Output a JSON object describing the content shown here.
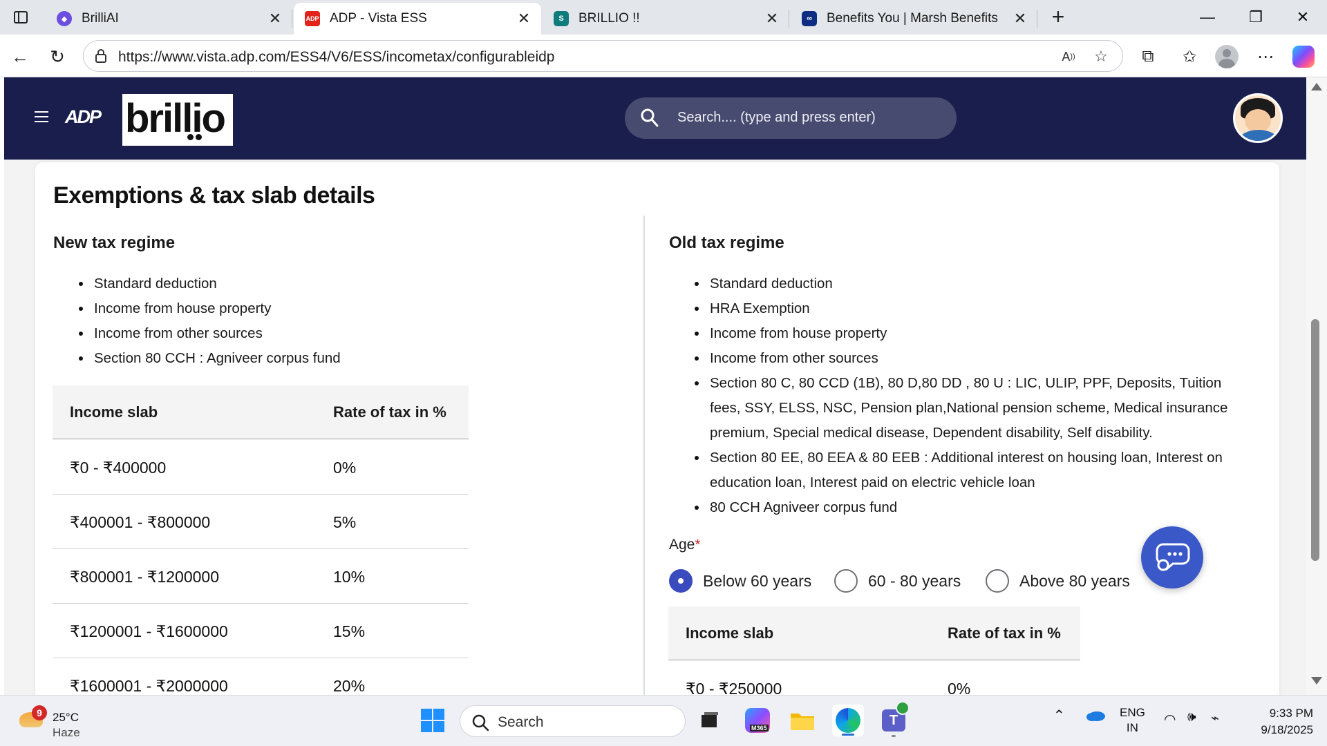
{
  "browser": {
    "tabs": [
      {
        "title": "BrilliAI",
        "favicon": "brilliai-icon",
        "color": "#6b4fe0"
      },
      {
        "title": "ADP - Vista ESS",
        "favicon": "adp-icon",
        "color": "#e2231a"
      },
      {
        "title": "BRILLIO !!",
        "favicon": "sharepoint-icon",
        "color": "#0f7c7b"
      },
      {
        "title": "Benefits You | Marsh Benefits",
        "favicon": "marsh-icon",
        "color": "#0c2d83"
      }
    ],
    "url": "https://www.vista.adp.com/ESS4/V6/ESS/incometax/configurableidp"
  },
  "header": {
    "adp_logo": "ADP",
    "brillio_logo": "brillio",
    "search_placeholder": "Search.... (type and press enter)",
    "brand_color": "#1a1e4d"
  },
  "page": {
    "title": "Exemptions & tax slab details",
    "new_regime": {
      "title": "New tax regime",
      "items": [
        "Standard deduction",
        "Income from house property",
        "Income from other sources",
        "Section 80 CCH : Agniveer corpus fund"
      ],
      "table": {
        "headers": [
          "Income slab",
          "Rate of tax in %"
        ],
        "rows": [
          [
            "₹0 - ₹400000",
            "0%"
          ],
          [
            "₹400001 - ₹800000",
            "5%"
          ],
          [
            "₹800001 - ₹1200000",
            "10%"
          ],
          [
            "₹1200001 - ₹1600000",
            "15%"
          ],
          [
            "₹1600001 - ₹2000000",
            "20%"
          ]
        ]
      }
    },
    "old_regime": {
      "title": "Old tax regime",
      "items": [
        "Standard deduction",
        "HRA Exemption",
        "Income from house property",
        "Income from other sources",
        "Section 80 C, 80 CCD (1B), 80 D,80 DD , 80 U : LIC, ULIP, PPF, Deposits, Tuition",
        "fees, SSY, ELSS, NSC, Pension plan,National pension scheme, Medical insurance",
        "premium, Special medical disease, Dependent disability, Self disability.",
        "Section 80 EE, 80 EEA & 80 EEB : Additional interest on housing loan, Interest on",
        "education loan, Interest paid on electric vehicle loan",
        "80 CCH Agniveer corpus fund"
      ],
      "age_label": "Age",
      "age_required": "*",
      "age_options": [
        "Below 60 years",
        "60 - 80 years",
        "Above 80 years"
      ],
      "age_selected": "Below 60 years",
      "table": {
        "headers": [
          "Income slab",
          "Rate of tax in %"
        ],
        "rows": [
          [
            "₹0 - ₹250000",
            "0%"
          ]
        ]
      }
    },
    "accent_color": "#3a4bbd"
  },
  "taskbar": {
    "weather_badge": "9",
    "temperature": "25°C",
    "condition": "Haze",
    "search_placeholder": "Search",
    "m365_label": "M365",
    "language_line1": "ENG",
    "language_line2": "IN",
    "time": "9:33 PM",
    "date": "9/18/2025"
  }
}
